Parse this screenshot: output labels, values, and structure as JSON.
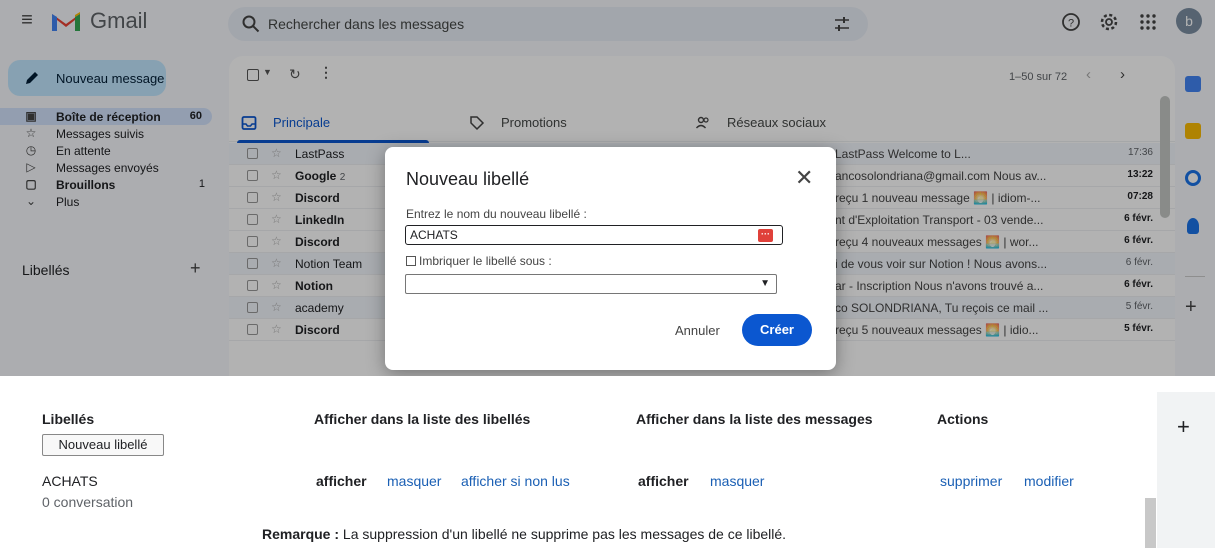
{
  "app": {
    "name": "Gmail"
  },
  "search": {
    "placeholder": "Rechercher dans les messages"
  },
  "user": {
    "avatar_letter": "b"
  },
  "compose": {
    "label": "Nouveau message"
  },
  "nav": [
    {
      "label": "Boîte de réception",
      "count": "60",
      "icon": "inbox-icon"
    },
    {
      "label": "Messages suivis",
      "count": "",
      "icon": "star-icon"
    },
    {
      "label": "En attente",
      "count": "",
      "icon": "clock-icon"
    },
    {
      "label": "Messages envoyés",
      "count": "",
      "icon": "send-icon"
    },
    {
      "label": "Brouillons",
      "count": "1",
      "icon": "draft-icon"
    },
    {
      "label": "Plus",
      "count": "",
      "icon": "chevron-down-icon"
    }
  ],
  "labels_title": "Libellés",
  "toolbar": {
    "pager": "1–50 sur 72"
  },
  "tabs": [
    {
      "label": "Principale"
    },
    {
      "label": "Promotions"
    },
    {
      "label": "Réseaux sociaux"
    }
  ],
  "emails": [
    {
      "from": "LastPass",
      "count": "",
      "subject": "LastPass Welcome to L...",
      "time": "17:36",
      "unread": false
    },
    {
      "from": "Google",
      "count": "2",
      "subject": "ancosolondriana@gmail.com Nous av...",
      "time": "13:22",
      "unread": true
    },
    {
      "from": "Discord",
      "count": "",
      "subject": "reçu 1 nouveau message 🌅 | idiom-...",
      "time": "07:28",
      "unread": true
    },
    {
      "from": "LinkedIn",
      "count": "",
      "subject": "nt d'Exploitation Transport - 03 vende...",
      "time": "6 févr.",
      "unread": true
    },
    {
      "from": "Discord",
      "count": "",
      "subject": "reçu 4 nouveaux messages 🌅 | wor...",
      "time": "6 févr.",
      "unread": true
    },
    {
      "from": "Notion Team",
      "count": "",
      "subject": "i de vous voir sur Notion ! Nous avons...",
      "time": "6 févr.",
      "unread": false
    },
    {
      "from": "Notion",
      "count": "",
      "subject": "ar - Inscription Nous n'avons trouvé a...",
      "time": "6 févr.",
      "unread": true
    },
    {
      "from": "academy",
      "count": "",
      "subject": "co SOLONDRIANA, Tu reçois ce mail ...",
      "time": "5 févr.",
      "unread": false
    },
    {
      "from": "Discord",
      "count": "",
      "subject": "reçu 5 nouveaux messages 🌅 | idio...",
      "time": "5 févr.",
      "unread": true
    }
  ],
  "dialog": {
    "title": "Nouveau libellé",
    "prompt": "Entrez le nom du nouveau libellé :",
    "input_value": "ACHATS",
    "nest_label": "Imbriquer le libellé sous :",
    "cancel": "Annuler",
    "create": "Créer"
  },
  "settings": {
    "col_labels": "Libellés",
    "col_show_list": "Afficher dans la liste des libellés",
    "col_show_msgs": "Afficher dans la liste des messages",
    "col_actions": "Actions",
    "new_label_btn": "Nouveau libellé",
    "label_name": "ACHATS",
    "label_count": "0 conversation",
    "list_show": "afficher",
    "list_hide": "masquer",
    "list_unread": "afficher si non lus",
    "msg_show": "afficher",
    "msg_hide": "masquer",
    "delete": "supprimer",
    "edit": "modifier",
    "note_bold": "Remarque :",
    "note_text": " La suppression d'un libellé ne supprime pas les messages de ce libellé."
  },
  "colors": {
    "accent": "#0b57d0",
    "compose_bg": "#c2e7ff",
    "active_nav": "#d3e3fd",
    "link": "#1a5fb4"
  }
}
